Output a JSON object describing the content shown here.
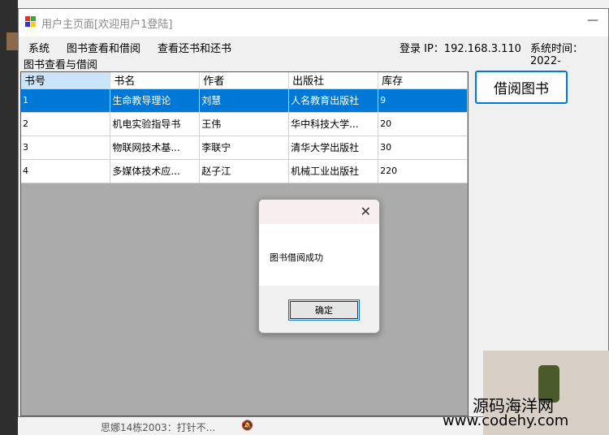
{
  "window": {
    "title": "用户主页面[欢迎用户1登陆]",
    "minimize_glyph": "—"
  },
  "menu": {
    "items": [
      "系统",
      "图书查看和借阅",
      "查看还书和还书"
    ]
  },
  "status": {
    "login_ip": "登录 IP：192.168.3.110",
    "system_time": "系统时间：2022-"
  },
  "group_label": "图书查看与借阅",
  "table": {
    "columns": [
      "书号",
      "书名",
      "作者",
      "出版社",
      "库存"
    ],
    "rows": [
      [
        "1",
        "生命教导理论",
        "刘慧",
        "人名教育出版社",
        "9"
      ],
      [
        "2",
        "机电实验指导书",
        "王伟",
        "华中科技大学...",
        "20"
      ],
      [
        "3",
        "物联网技术基...",
        "李联宁",
        "清华大学出版社",
        "30"
      ],
      [
        "4",
        "多媒体技术应...",
        "赵子江",
        "机械工业出版社",
        "220"
      ]
    ],
    "selected_row": 0
  },
  "borrow_button": "借阅图书",
  "dialog": {
    "close_glyph": "✕",
    "message": "图书借阅成功",
    "ok_label": "确定"
  },
  "taskbar": {
    "chat_text": "思娜14栋2003：打针不..."
  },
  "watermark": {
    "line1": "源码海洋网",
    "line2": "www.codehy.com"
  },
  "colors": {
    "selection": "#0078d7",
    "header_selected": "#cce4f7",
    "grid_background": "#ababab"
  }
}
